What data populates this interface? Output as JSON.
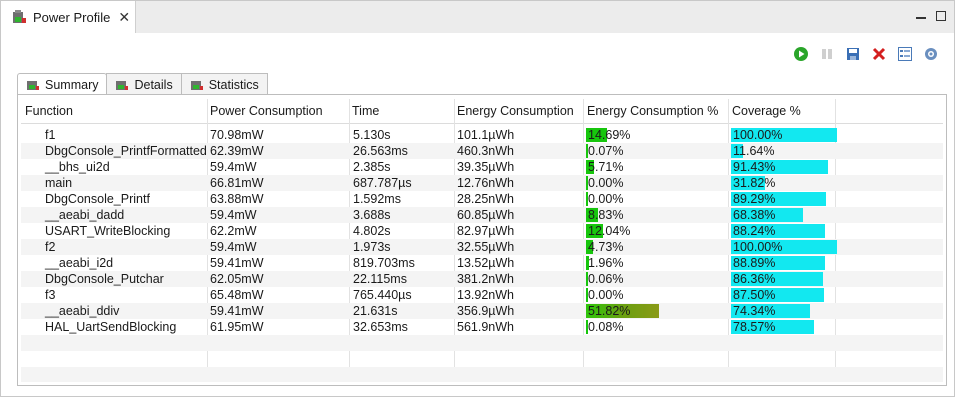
{
  "window": {
    "tab_label": "Power Profile",
    "close_glyph": "✕",
    "minimize_icon": "minimize-icon",
    "maximize_icon": "maximize-icon"
  },
  "toolbar": {
    "icons": [
      "play-icon",
      "pause-icon",
      "save-icon",
      "delete-icon",
      "settings-list-icon",
      "configure-icon"
    ]
  },
  "tabs": [
    {
      "label": "Summary",
      "active": true
    },
    {
      "label": "Details",
      "active": false
    },
    {
      "label": "Statistics",
      "active": false
    }
  ],
  "table": {
    "headers": [
      "Function",
      "Power Consumption",
      "Time",
      "Energy Consumption",
      "Energy Consumption %",
      "Coverage %"
    ],
    "rows": [
      {
        "function": "f1",
        "power": "70.98mW",
        "time": " 5.130s",
        "energy": "101.1µWh",
        "energy_pct_text": "14.69%",
        "energy_pct": 14.69,
        "coverage_text": "100.00%",
        "coverage": 100.0
      },
      {
        "function": "DbgConsole_PrintfFormatted",
        "power": "62.39mW",
        "time": "26.563ms",
        "energy": "460.3nWh",
        "energy_pct_text": "0.07%",
        "energy_pct": 0.07,
        "coverage_text": "11.64%",
        "coverage": 11.64
      },
      {
        "function": "__bhs_ui2d",
        "power": "59.4mW",
        "time": " 2.385s",
        "energy": "39.35µWh",
        "energy_pct_text": "5.71%",
        "energy_pct": 5.71,
        "coverage_text": "91.43%",
        "coverage": 91.43
      },
      {
        "function": "main",
        "power": "66.81mW",
        "time": "687.787µs",
        "energy": "12.76nWh",
        "energy_pct_text": "0.00%",
        "energy_pct": 0.0,
        "coverage_text": "31.82%",
        "coverage": 31.82
      },
      {
        "function": "DbgConsole_Printf",
        "power": "63.88mW",
        "time": " 1.592ms",
        "energy": "28.25nWh",
        "energy_pct_text": "0.00%",
        "energy_pct": 0.0,
        "coverage_text": "89.29%",
        "coverage": 89.29
      },
      {
        "function": "__aeabi_dadd",
        "power": "59.4mW",
        "time": " 3.688s",
        "energy": "60.85µWh",
        "energy_pct_text": "8.83%",
        "energy_pct": 8.83,
        "coverage_text": "68.38%",
        "coverage": 68.38
      },
      {
        "function": "USART_WriteBlocking",
        "power": "62.2mW",
        "time": " 4.802s",
        "energy": "82.97µWh",
        "energy_pct_text": "12.04%",
        "energy_pct": 12.04,
        "coverage_text": "88.24%",
        "coverage": 88.24
      },
      {
        "function": "f2",
        "power": "59.4mW",
        "time": " 1.973s",
        "energy": "32.55µWh",
        "energy_pct_text": "4.73%",
        "energy_pct": 4.73,
        "coverage_text": "100.00%",
        "coverage": 100.0
      },
      {
        "function": "__aeabi_i2d",
        "power": "59.41mW",
        "time": "819.703ms",
        "energy": "13.52µWh",
        "energy_pct_text": "1.96%",
        "energy_pct": 1.96,
        "coverage_text": "88.89%",
        "coverage": 88.89
      },
      {
        "function": "DbgConsole_Putchar",
        "power": "62.05mW",
        "time": "22.115ms",
        "energy": "381.2nWh",
        "energy_pct_text": "0.06%",
        "energy_pct": 0.06,
        "coverage_text": "86.36%",
        "coverage": 86.36
      },
      {
        "function": "f3",
        "power": "65.48mW",
        "time": "765.440µs",
        "energy": "13.92nWh",
        "energy_pct_text": "0.00%",
        "energy_pct": 0.0,
        "coverage_text": "87.50%",
        "coverage": 87.5
      },
      {
        "function": "__aeabi_ddiv",
        "power": "59.41mW",
        "time": "21.631s",
        "energy": "356.9µWh",
        "energy_pct_text": "51.82%",
        "energy_pct": 51.82,
        "coverage_text": "74.34%",
        "coverage": 74.34
      },
      {
        "function": "HAL_UartSendBlocking",
        "power": "61.95mW",
        "time": "32.653ms",
        "energy": "561.9nWh",
        "energy_pct_text": "0.08%",
        "energy_pct": 0.08,
        "coverage_text": "78.57%",
        "coverage": 78.57
      }
    ]
  },
  "colors": {
    "energy_bar": "#17c60d",
    "coverage_bar": "#12e8f0",
    "alt_row": "#f4f4f4"
  }
}
